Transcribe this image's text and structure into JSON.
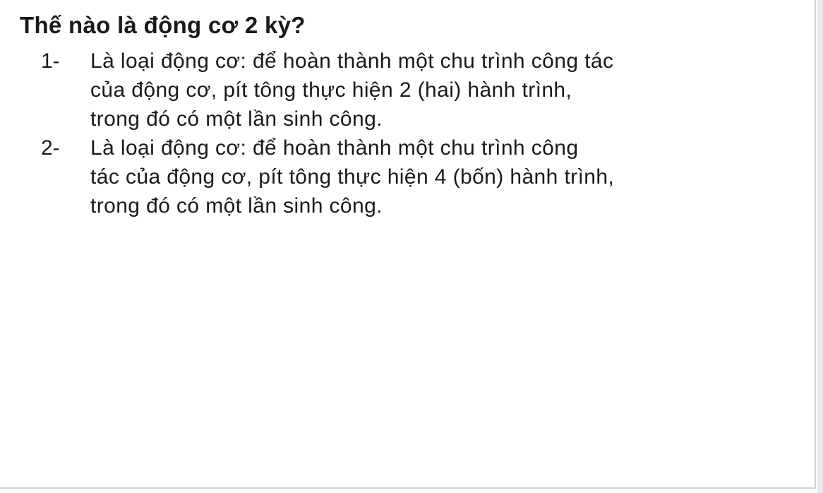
{
  "question": "Thế nào là động cơ 2 kỳ?",
  "options": [
    {
      "number": "1-",
      "text": "Là loại động cơ: để hoàn thành một chu trình công tác\ncủa động cơ, pít tông thực hiện 2 (hai) hành trình,\ntrong đó có một lần sinh công."
    },
    {
      "number": "2-",
      "text": "Là loại động cơ: để hoàn thành một chu trình công\ntác của động cơ, pít tông thực hiện 4 (bốn) hành trình,\ntrong đó có một lần sinh công."
    }
  ]
}
